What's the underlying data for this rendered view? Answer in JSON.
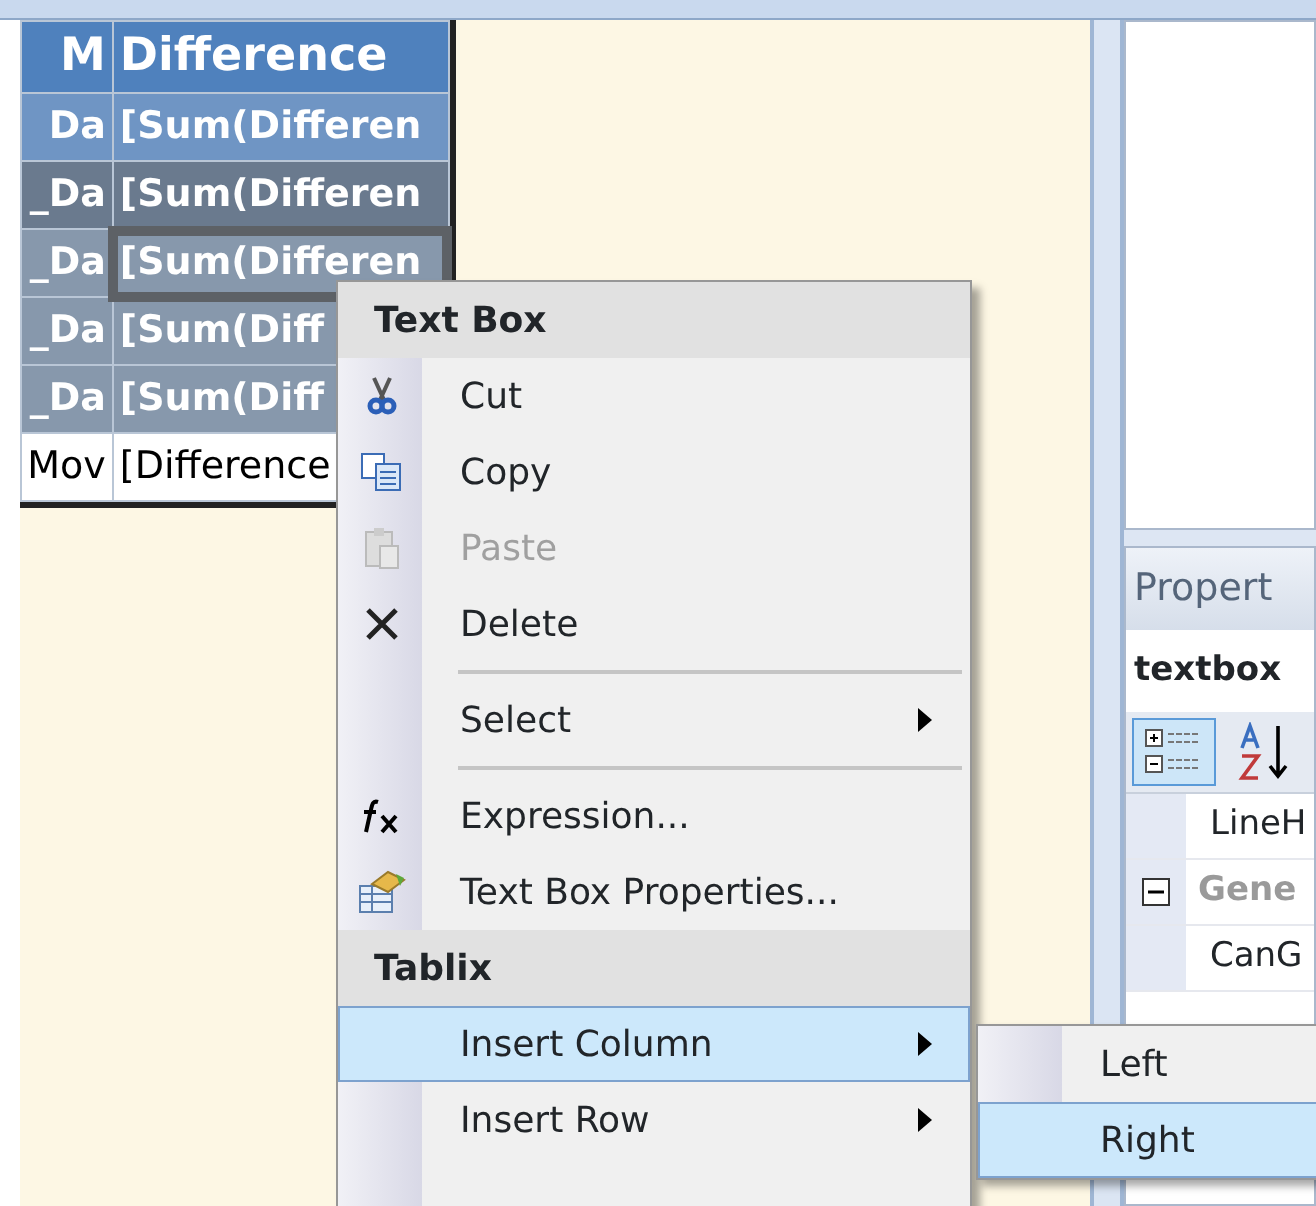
{
  "table": {
    "columns": [
      "M",
      "Difference"
    ],
    "rows": [
      {
        "cells": [
          "Da",
          "[Sum(Differen"
        ],
        "kind": "detail",
        "selected": false
      },
      {
        "cells": [
          "_Da",
          "[Sum(Differen"
        ],
        "kind": "dark",
        "selected": false
      },
      {
        "cells": [
          "_Da",
          "[Sum(Differen"
        ],
        "kind": "group",
        "selected": true
      },
      {
        "cells": [
          "_Da",
          "[Sum(Diff"
        ],
        "kind": "group",
        "selected": false
      },
      {
        "cells": [
          "_Da",
          "[Sum(Diff"
        ],
        "kind": "group",
        "selected": false
      },
      {
        "cells": [
          "Mov",
          "[Difference"
        ],
        "kind": "total",
        "selected": false
      }
    ]
  },
  "context_menu": {
    "items": [
      {
        "kind": "header",
        "label": "Text Box"
      },
      {
        "kind": "item",
        "label": "Cut",
        "disabled": false,
        "submenu": false,
        "selected": false
      },
      {
        "kind": "item",
        "label": "Copy",
        "disabled": false,
        "submenu": false,
        "selected": false
      },
      {
        "kind": "item",
        "label": "Paste",
        "disabled": true,
        "submenu": false,
        "selected": false
      },
      {
        "kind": "item",
        "label": "Delete",
        "disabled": false,
        "submenu": false,
        "selected": false
      },
      {
        "kind": "separator"
      },
      {
        "kind": "item",
        "label": "Select",
        "disabled": false,
        "submenu": true,
        "selected": false
      },
      {
        "kind": "separator"
      },
      {
        "kind": "item",
        "label": "Expression...",
        "disabled": false,
        "submenu": false,
        "selected": false
      },
      {
        "kind": "item",
        "label": "Text Box Properties...",
        "disabled": false,
        "submenu": false,
        "selected": false
      },
      {
        "kind": "header",
        "label": "Tablix"
      },
      {
        "kind": "item",
        "label": "Insert Column",
        "disabled": false,
        "submenu": true,
        "selected": true
      },
      {
        "kind": "item",
        "label": "Insert Row",
        "disabled": false,
        "submenu": true,
        "selected": false
      }
    ]
  },
  "submenu": {
    "items": [
      {
        "label": "Left",
        "selected": false
      },
      {
        "label": "Right",
        "selected": true
      }
    ]
  },
  "properties": {
    "title": "Propert",
    "object": "textbox",
    "toolbar": [
      {
        "selected": true
      },
      {
        "selected": false
      }
    ],
    "rows": [
      {
        "kind": "property",
        "label": "LineH"
      },
      {
        "kind": "category",
        "label": "Gene",
        "expanded": true
      },
      {
        "kind": "property",
        "label": "CanG"
      }
    ]
  }
}
